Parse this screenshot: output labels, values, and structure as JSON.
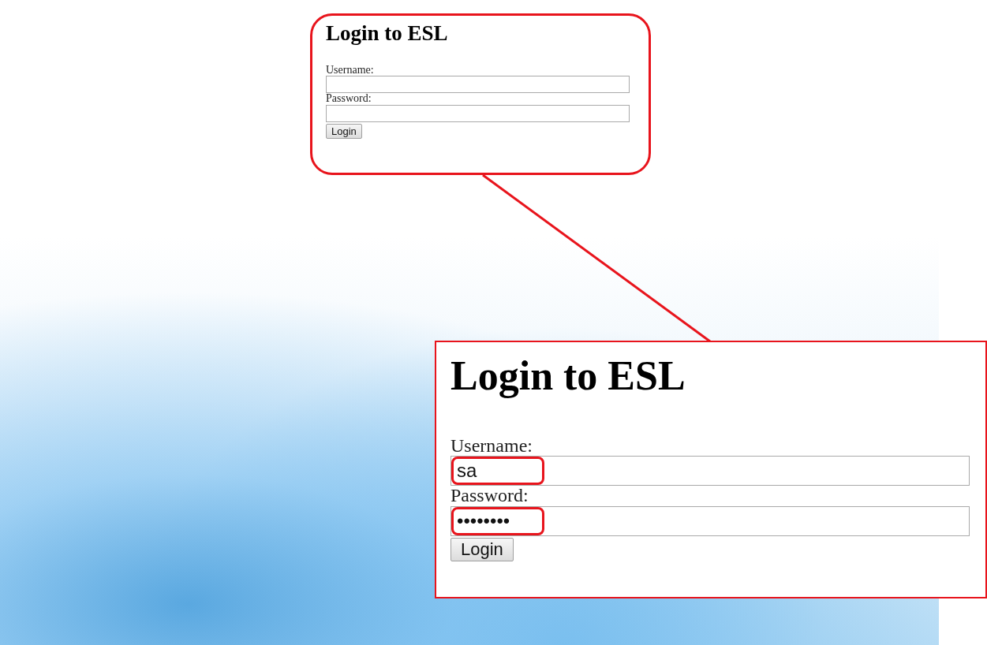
{
  "callouts": [
    {
      "kind": "original",
      "title": "Login to ESL",
      "fields": [
        {
          "label": "Username:",
          "highlighted": false
        },
        {
          "label": "Password:",
          "highlighted": false
        }
      ],
      "button": "Login"
    },
    {
      "kind": "magnified",
      "title": "Login to ESL",
      "fields": [
        {
          "label": "Username:",
          "value": "sa",
          "highlighted": true
        },
        {
          "label": "Password:",
          "value": "••••••••",
          "highlighted": true
        }
      ],
      "button": "Login"
    }
  ]
}
